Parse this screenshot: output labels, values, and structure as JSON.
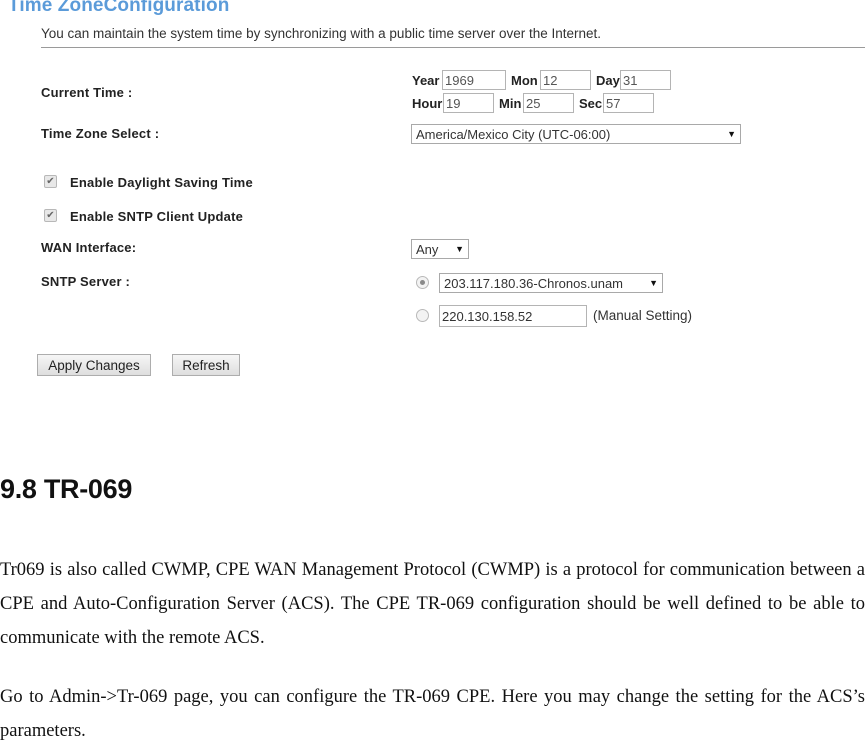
{
  "screenshot": {
    "title": "Time ZoneConfiguration",
    "description": "You can maintain the system time by synchronizing with a public time server over the Internet.",
    "current_time": {
      "label": "Current Time :",
      "year_label": "Year",
      "year": "1969",
      "mon_label": "Mon",
      "mon": "12",
      "day_label": "Day",
      "day": "31",
      "hour_label": "Hour",
      "hour": "19",
      "min_label": "Min",
      "min": "25",
      "sec_label": "Sec",
      "sec": "57"
    },
    "time_zone": {
      "label": "Time Zone Select :",
      "selected": "America/Mexico City (UTC-06:00)"
    },
    "daylight_saving": {
      "label": "Enable Daylight Saving Time",
      "checked": true
    },
    "sntp_client": {
      "label": "Enable SNTP Client Update",
      "checked": true
    },
    "wan_interface": {
      "label": "WAN Interface:",
      "selected": "Any"
    },
    "sntp_server": {
      "label": "SNTP Server :",
      "preset_selected": "203.117.180.36-Chronos.unam",
      "preset_checked": true,
      "manual_value": "220.130.158.52",
      "manual_checked": false,
      "manual_label": "(Manual Setting)"
    },
    "buttons": {
      "apply": "Apply Changes",
      "refresh": "Refresh"
    }
  },
  "document": {
    "heading": "9.8 TR-069",
    "paragraph1": "Tr069 is also called CWMP, CPE WAN Management Protocol (CWMP) is a protocol for communication between a CPE and Auto-Configuration Server (ACS). The CPE TR-069 configuration should be well defined to be able to communicate with the remote ACS.",
    "paragraph2": "Go to Admin->Tr-069 page, you can configure the TR-069 CPE. Here you may change the setting for the ACS’s parameters."
  },
  "icons": {
    "checkbox_check": "✔",
    "dropdown_arrow": "▼"
  }
}
